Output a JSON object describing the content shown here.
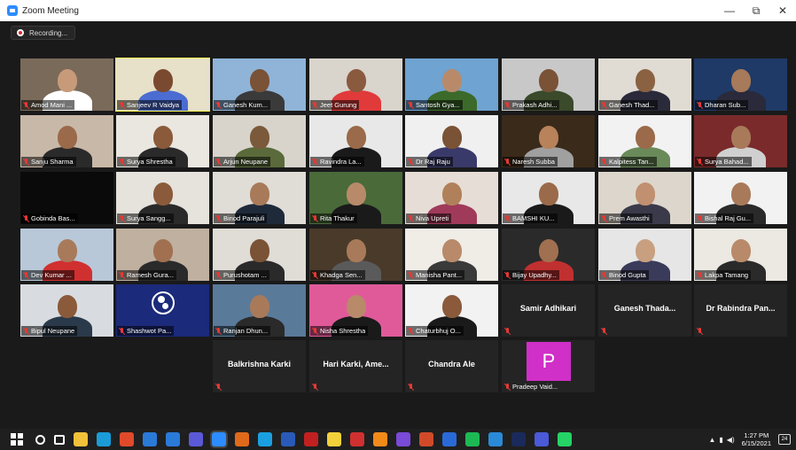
{
  "window": {
    "title": "Zoom Meeting",
    "controls": {
      "minimize": "—",
      "restore": "⧉",
      "close": "✕"
    }
  },
  "recording": {
    "label": "Recording..."
  },
  "participants": [
    {
      "name": "Amod Mani ...",
      "video": true,
      "colors": [
        "#7a6a5a",
        "#c79a7a",
        "#ffffff"
      ]
    },
    {
      "name": "Sanjeev R Vaidya",
      "video": true,
      "speaking": true,
      "colors": [
        "#e6e1c8",
        "#7a4a30",
        "#4b6cd1"
      ]
    },
    {
      "name": "Ganesh Kum...",
      "video": true,
      "colors": [
        "#8fb4d8",
        "#7a5236",
        "#3a3a3a"
      ]
    },
    {
      "name": "Jeet Gurung",
      "video": true,
      "colors": [
        "#d9d4cc",
        "#8a5a3e",
        "#e03a3a"
      ]
    },
    {
      "name": "Santosh Gya...",
      "video": true,
      "colors": [
        "#6fa3d1",
        "#b88a6a",
        "#3c6a2a"
      ]
    },
    {
      "name": "Prakash Adhi...",
      "video": true,
      "colors": [
        "#c8c8c8",
        "#7a5236",
        "#3a4a2a"
      ]
    },
    {
      "name": "Ganesh Thad...",
      "video": true,
      "colors": [
        "#e0dcd4",
        "#8a6242",
        "#2a2a3a"
      ]
    },
    {
      "name": "Dharan Sub...",
      "video": true,
      "colors": [
        "#1f3a66",
        "#a67a5a",
        "#2a2a3a"
      ]
    },
    {
      "name": "Sanju Sharma",
      "video": true,
      "colors": [
        "#c8b8a8",
        "#9a6a4a",
        "#2a2a2a"
      ]
    },
    {
      "name": "Surya Shrestha",
      "video": true,
      "colors": [
        "#eae6e0",
        "#8a5a3a",
        "#2a2a2a"
      ]
    },
    {
      "name": "Arjun Neupane",
      "video": true,
      "colors": [
        "#d8d4cc",
        "#7a5a3a",
        "#5a6a3a"
      ]
    },
    {
      "name": "Ravindra La...",
      "video": true,
      "colors": [
        "#e8e8e8",
        "#9a6a4a",
        "#1a1a1a"
      ]
    },
    {
      "name": "Dr Raj Raju",
      "video": true,
      "colors": [
        "#f0f0f0",
        "#7a5236",
        "#3a3a6a"
      ]
    },
    {
      "name": "Naresh Subba",
      "video": true,
      "colors": [
        "#3a2a1a",
        "#b8825a",
        "#a0a0a0"
      ]
    },
    {
      "name": "Kalpitess Tan...",
      "video": true,
      "colors": [
        "#f2f2f2",
        "#9a6a4a",
        "#6a8a5a"
      ]
    },
    {
      "name": "Surya Bahad...",
      "video": true,
      "colors": [
        "#7a2a2a",
        "#a87a5a",
        "#d0d0d0"
      ]
    },
    {
      "name": "Gobinda Bas...",
      "video": true,
      "colors": [
        "#0a0a0a",
        "#0a0a0a",
        "#0a0a0a"
      ]
    },
    {
      "name": "Surya Sangg...",
      "video": true,
      "colors": [
        "#e6e2dc",
        "#8a5a3a",
        "#2a2a2a"
      ]
    },
    {
      "name": "Binod Parajuli",
      "video": true,
      "colors": [
        "#e0dcd6",
        "#a87a5a",
        "#1e2a3a"
      ]
    },
    {
      "name": "Rita Thakur",
      "video": true,
      "colors": [
        "#4a6a3a",
        "#b88a6a",
        "#1a1a1a"
      ]
    },
    {
      "name": "Niva Upreti",
      "video": true,
      "colors": [
        "#e6ded6",
        "#b0805a",
        "#a03a5a"
      ]
    },
    {
      "name": "BAMSHI KU...",
      "video": true,
      "colors": [
        "#e8e8e8",
        "#9a6a4a",
        "#1a1a1a"
      ]
    },
    {
      "name": "Prem Awasthi",
      "video": true,
      "colors": [
        "#ddd6cc",
        "#c09070",
        "#3a3a4a"
      ]
    },
    {
      "name": "Bishal Raj Gu...",
      "video": true,
      "colors": [
        "#f2f2f2",
        "#a87a5a",
        "#2a2a2a"
      ]
    },
    {
      "name": "Dev Kumar ...",
      "video": true,
      "colors": [
        "#b8c8d8",
        "#a87a5a",
        "#d03030"
      ]
    },
    {
      "name": "Ramesh Gura...",
      "video": true,
      "colors": [
        "#c0b0a0",
        "#a07050",
        "#2a2a2a"
      ]
    },
    {
      "name": "Purushotam ...",
      "video": true,
      "colors": [
        "#e0dcd6",
        "#7a5236",
        "#2a2a2a"
      ]
    },
    {
      "name": "Khadga Sen...",
      "video": true,
      "colors": [
        "#4a3a2a",
        "#a87a5a",
        "#5a5a5a"
      ]
    },
    {
      "name": "Manisha Pant...",
      "video": true,
      "colors": [
        "#f0ece6",
        "#b88a6a",
        "#3a3a3a"
      ]
    },
    {
      "name": "Bijay Upadhy...",
      "video": true,
      "colors": [
        "#2a2a2a",
        "#a07050",
        "#c03030"
      ]
    },
    {
      "name": "Binod Gupta",
      "video": true,
      "colors": [
        "#e6e6e6",
        "#c8a080",
        "#3a3a5a"
      ]
    },
    {
      "name": "Lakpa Tamang",
      "video": true,
      "colors": [
        "#ece8e2",
        "#b88a6a",
        "#2a2a2a"
      ]
    },
    {
      "name": "Bipul Neupane",
      "video": true,
      "colors": [
        "#d8dce0",
        "#8a5a3a",
        "#2a3a4a"
      ]
    },
    {
      "name": "Shashwot Pa...",
      "video": true,
      "obs": true,
      "colors": [
        "#1b2a7a",
        "#1b2a7a",
        "#1b2a7a"
      ]
    },
    {
      "name": "Ranjan Dhun...",
      "video": true,
      "colors": [
        "#5a7a9a",
        "#a87a5a",
        "#2a2a2a"
      ]
    },
    {
      "name": "Nisha Shrestha",
      "video": true,
      "colors": [
        "#e05a9a",
        "#b88a6a",
        "#1a1a1a"
      ]
    },
    {
      "name": "Chaturbhuj O...",
      "video": true,
      "colors": [
        "#f2f2f2",
        "#8a5a3a",
        "#1a1a1a"
      ]
    },
    {
      "name": "Samir Adhikari",
      "video": false
    },
    {
      "name": "Ganesh Thada...",
      "video": false
    },
    {
      "name": "Dr Rabindra Pan...",
      "video": false
    },
    {
      "name": "Balkrishna Karki",
      "video": false
    },
    {
      "name": "Hari Karki, Ame...",
      "video": false
    },
    {
      "name": "Chandra Ale",
      "video": false
    },
    {
      "name": "Pradeep Vaid...",
      "video": false,
      "avatar": "P"
    }
  ],
  "taskbar": {
    "clock_time": "1:27 PM",
    "clock_date": "6/15/2021",
    "notifications": "24",
    "apps": [
      "search-icon",
      "task-view-icon",
      "file-explorer-icon",
      "edge-icon",
      "chrome-icon",
      "store-icon",
      "mail-icon",
      "teams-icon",
      "zoom-icon",
      "firefox-icon",
      "skype-icon",
      "word-icon",
      "filezilla-icon",
      "sticky-notes-icon",
      "acrobat-icon",
      "vlc-icon",
      "viber-icon",
      "powerpoint-icon",
      "outlook-icon",
      "spotify-icon",
      "onedrive-icon",
      "photoshop-icon",
      "teams2-icon",
      "whatsapp-icon"
    ],
    "app_colors": [
      "#1f1f1f",
      "#1f1f1f",
      "#f2c13a",
      "#1a9cd8",
      "#e04a2a",
      "#2a7ad8",
      "#2a7ad8",
      "#5a5ad8",
      "#2d8cff",
      "#e06a1a",
      "#1aa0e0",
      "#2a5ab8",
      "#c02020",
      "#f2d23a",
      "#d03030",
      "#f28a1a",
      "#7a4ad8",
      "#d04a2a",
      "#2a6ad8",
      "#1db954",
      "#2a8ad8",
      "#1a2a5a",
      "#4a5ad8",
      "#25d366"
    ]
  }
}
